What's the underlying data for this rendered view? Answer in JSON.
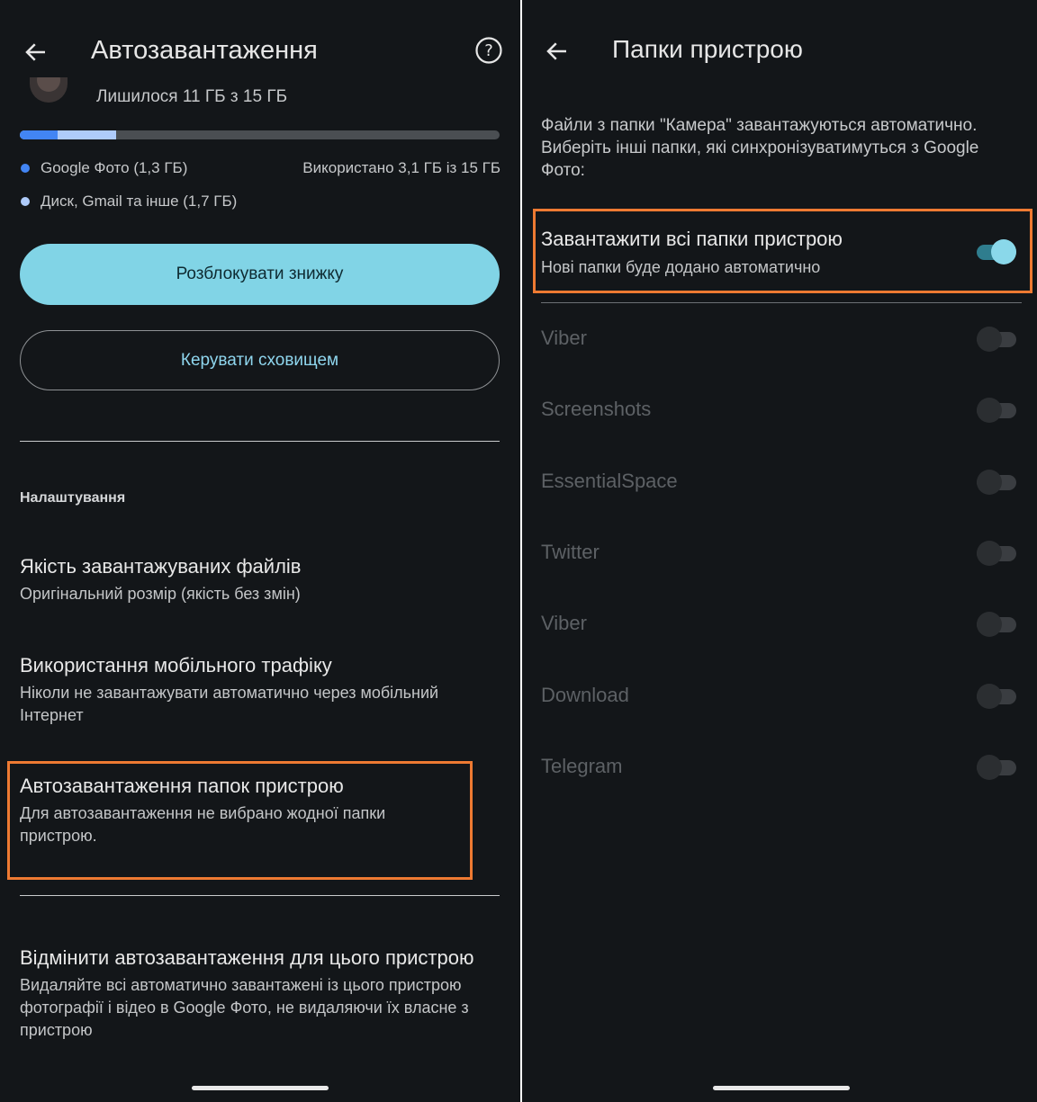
{
  "colors": {
    "background": "#131619",
    "accent": "#81d4e6",
    "highlight_border": "#ee7a32",
    "progress_photos": "#4285f4",
    "progress_drive": "#aecbfa"
  },
  "left": {
    "header": {
      "back_icon": "arrow-left-icon",
      "title": "Автозавантаження",
      "help_icon": "help-circle-icon"
    },
    "storage": {
      "remaining": "Лишилося 11 ГБ з 15 ГБ",
      "used_fraction": 0.2,
      "legend": [
        {
          "label": "Google Фото (1,3 ГБ)",
          "color": "#4285f4"
        },
        {
          "label": "Диск, Gmail та інше (1,7 ГБ)",
          "color": "#aecbfa"
        }
      ],
      "used_text": "Використано 3,1 ГБ із 15 ГБ"
    },
    "buttons": {
      "unlock_discount": "Розблокувати знижку",
      "manage_storage": "Керувати сховищем"
    },
    "settings_header": "Налаштування",
    "settings": {
      "quality": {
        "title": "Якість завантажуваних файлів",
        "subtitle": "Оригінальний розмір (якість без змін)"
      },
      "mobile_data": {
        "title": "Використання мобільного трафіку",
        "subtitle": "Ніколи не завантажувати автоматично через мобільний Інтернет"
      },
      "device_folders": {
        "title": "Автозавантаження папок пристрою",
        "subtitle": "Для автозавантаження не вибрано жодної папки пристрою."
      },
      "disable": {
        "title": "Відмінити автозавантаження для цього пристрою",
        "subtitle": "Видаляйте всі автоматично завантажені із цього пристрою фотографії і відео в Google Фото, не видаляючи їх власне з пристрою"
      }
    }
  },
  "right": {
    "header": {
      "back_icon": "arrow-left-icon",
      "title": "Папки пристрою"
    },
    "description": "Файли з папки \"Камера\" завантажуються автоматично. Виберіть інші папки, які синхронізуватимуться з Google Фото:",
    "upload_all": {
      "title": "Завантажити всі папки пристрою",
      "subtitle": "Нові папки буде додано автоматично",
      "enabled": true
    },
    "folders": [
      {
        "name": "Viber",
        "enabled": false
      },
      {
        "name": "Screenshots",
        "enabled": false
      },
      {
        "name": "EssentialSpace",
        "enabled": false
      },
      {
        "name": "Twitter",
        "enabled": false
      },
      {
        "name": "Viber",
        "enabled": false
      },
      {
        "name": "Download",
        "enabled": false
      },
      {
        "name": "Telegram",
        "enabled": false
      }
    ]
  }
}
